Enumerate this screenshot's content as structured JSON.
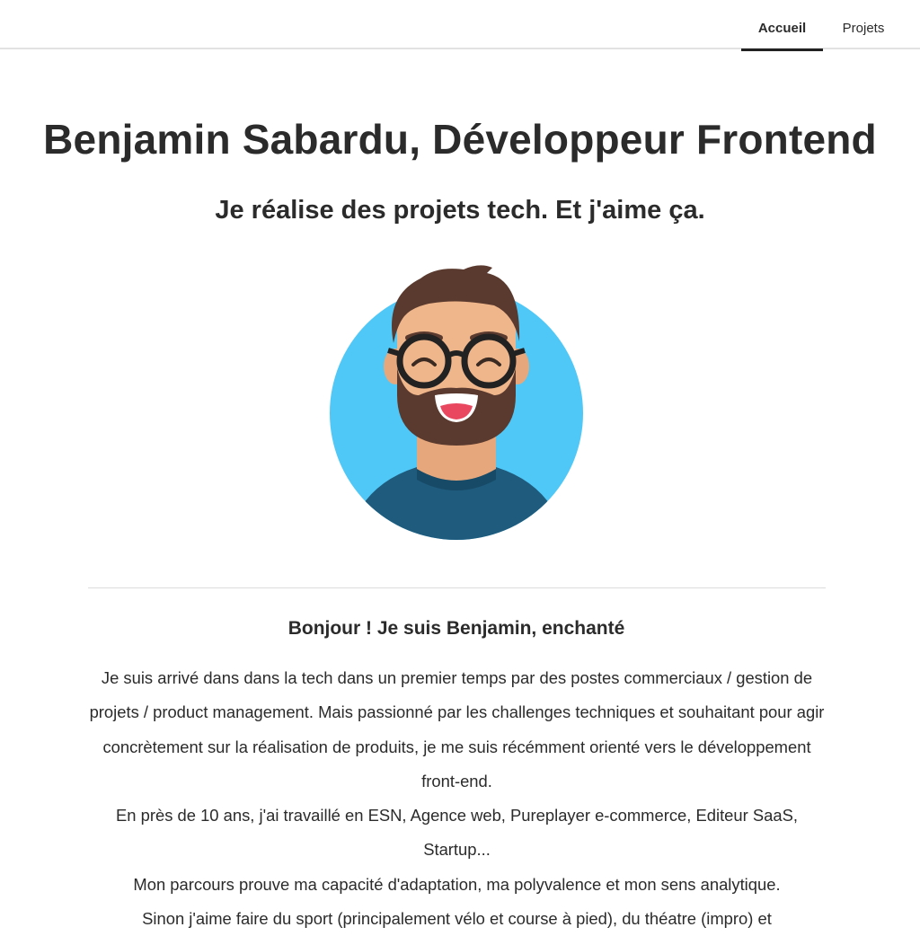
{
  "nav": {
    "tabs": [
      {
        "label": "Accueil",
        "active": true
      },
      {
        "label": "Projets",
        "active": false
      }
    ]
  },
  "hero": {
    "title": "Benjamin Sabardu, Développeur Frontend",
    "subtitle": "Je réalise des projets tech. Et j'aime ça."
  },
  "about": {
    "heading": "Bonjour ! Je suis Benjamin, enchanté",
    "paragraphs": [
      "Je suis arrivé dans dans la tech dans un premier temps par des postes commerciaux / gestion de projets / product management. Mais passionné par les challenges techniques et souhaitant pour agir concrètement sur la réalisation de produits, je me suis récémment orienté vers le développement front-end.",
      "En près de 10 ans, j'ai travaillé en ESN, Agence web, Pureplayer e-commerce, Editeur SaaS, Startup...",
      "Mon parcours prouve ma capacité d'adaptation, ma polyvalence et mon sens analytique.",
      "Sinon j'aime faire du sport (principalement vélo et course à pied), du théatre (impro) et"
    ]
  },
  "colors": {
    "avatar_bg": "#4fc8f7",
    "hair": "#5a3a2e",
    "skin": "#f0b68b",
    "shirt": "#1f5b7d"
  }
}
